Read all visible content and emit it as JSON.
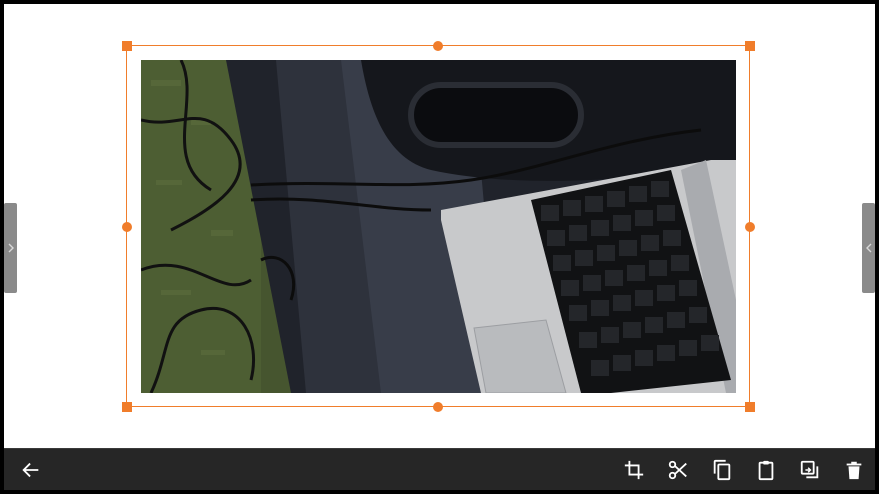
{
  "colors": {
    "accent": "#f07d2b",
    "toolbar_bg": "#262626",
    "icon": "#ffffff",
    "side_tab": "#8a8a8a"
  },
  "photo": {
    "subject": "laptop-keyboard-and-cables-photo"
  },
  "side_tabs": {
    "left_icon": "chevron-right-icon",
    "right_icon": "chevron-left-icon"
  },
  "toolbar": {
    "left": [
      {
        "icon": "back-arrow-icon"
      }
    ],
    "right": [
      {
        "icon": "crop-icon"
      },
      {
        "icon": "cut-icon"
      },
      {
        "icon": "copy-icon"
      },
      {
        "icon": "paste-icon"
      },
      {
        "icon": "duplicate-icon"
      },
      {
        "icon": "delete-icon"
      }
    ]
  }
}
